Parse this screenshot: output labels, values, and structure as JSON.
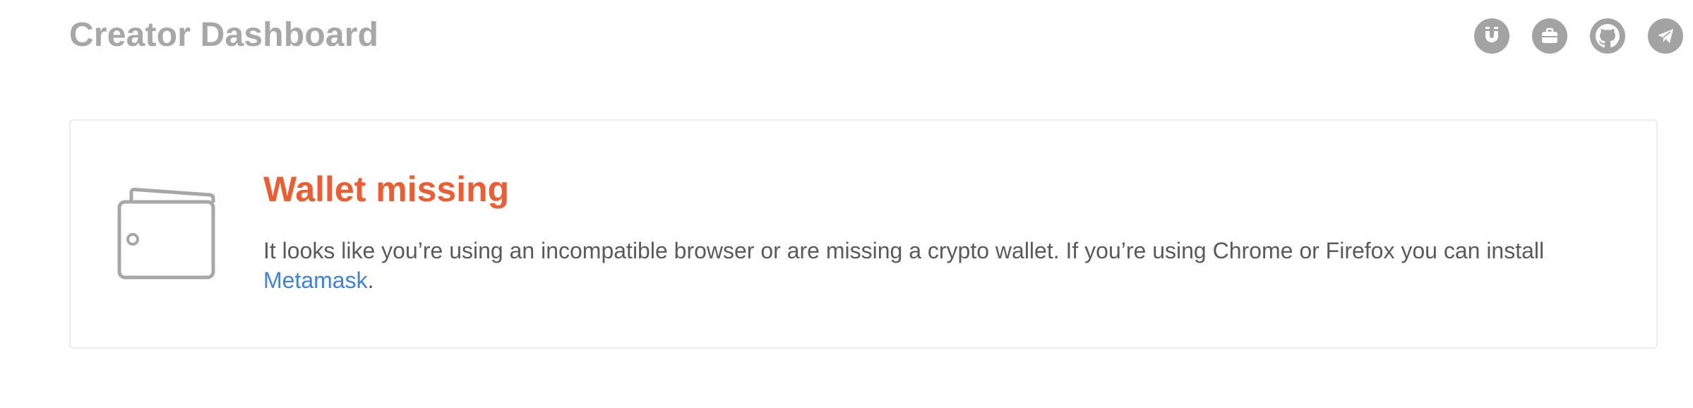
{
  "header": {
    "title": "Creator Dashboard",
    "icons": [
      {
        "name": "magnet-icon"
      },
      {
        "name": "briefcase-icon"
      },
      {
        "name": "github-icon"
      },
      {
        "name": "telegram-icon"
      }
    ]
  },
  "notice": {
    "title": "Wallet missing",
    "message": "It looks like you’re using an incompatible browser or are missing a crypto wallet. If you’re using Chrome or Firefox you can install ",
    "link_label": "Metamask",
    "suffix": "."
  },
  "colors": {
    "title": "#a7a7a7",
    "icon_bg": "#a3a3a3",
    "alert": "#ec5d33",
    "link": "#3d82dd",
    "body_text": "#5a5a5a",
    "card_border": "#ececec"
  }
}
